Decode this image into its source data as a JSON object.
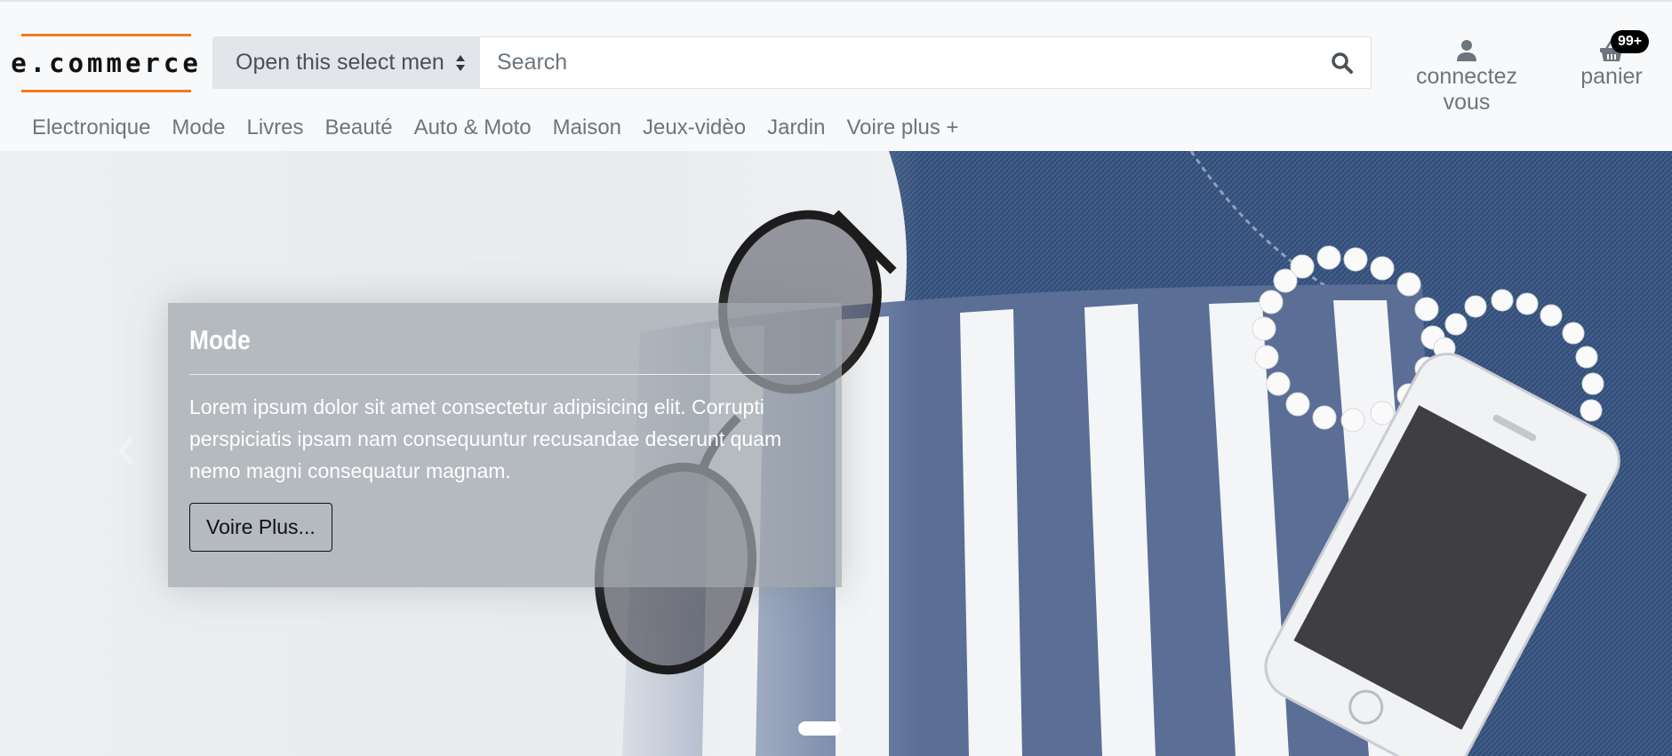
{
  "brand": {
    "logo_text": "e.commerce",
    "accent_color": "#f07b22"
  },
  "search": {
    "category_select": {
      "selected": "Open this select menu",
      "icon": "sort-caret-icon"
    },
    "placeholder": "Search",
    "button_icon": "search-icon"
  },
  "account": {
    "label": "connectez vous",
    "icon": "user-icon"
  },
  "cart": {
    "label": "panier",
    "badge": "99+",
    "icon": "basket-icon"
  },
  "nav": {
    "items": [
      {
        "label": "Electronique"
      },
      {
        "label": "Mode"
      },
      {
        "label": "Livres"
      },
      {
        "label": "Beauté"
      },
      {
        "label": "Auto & Moto"
      },
      {
        "label": "Maison"
      },
      {
        "label": "Jeux-vidèo"
      },
      {
        "label": "Jardin"
      },
      {
        "label": "Voire plus +"
      }
    ]
  },
  "hero": {
    "caption_title": "Mode",
    "caption_text": "Lorem ipsum dolor sit amet consectetur adipisicing elit. Corrupti perspiciatis ipsam nam consequuntur recusandae deserunt quam nemo magni consequatur magnam.",
    "button_label": "Voire Plus...",
    "prev_icon": "chevron-left-icon",
    "slides_total": 1,
    "active_slide": 1
  }
}
